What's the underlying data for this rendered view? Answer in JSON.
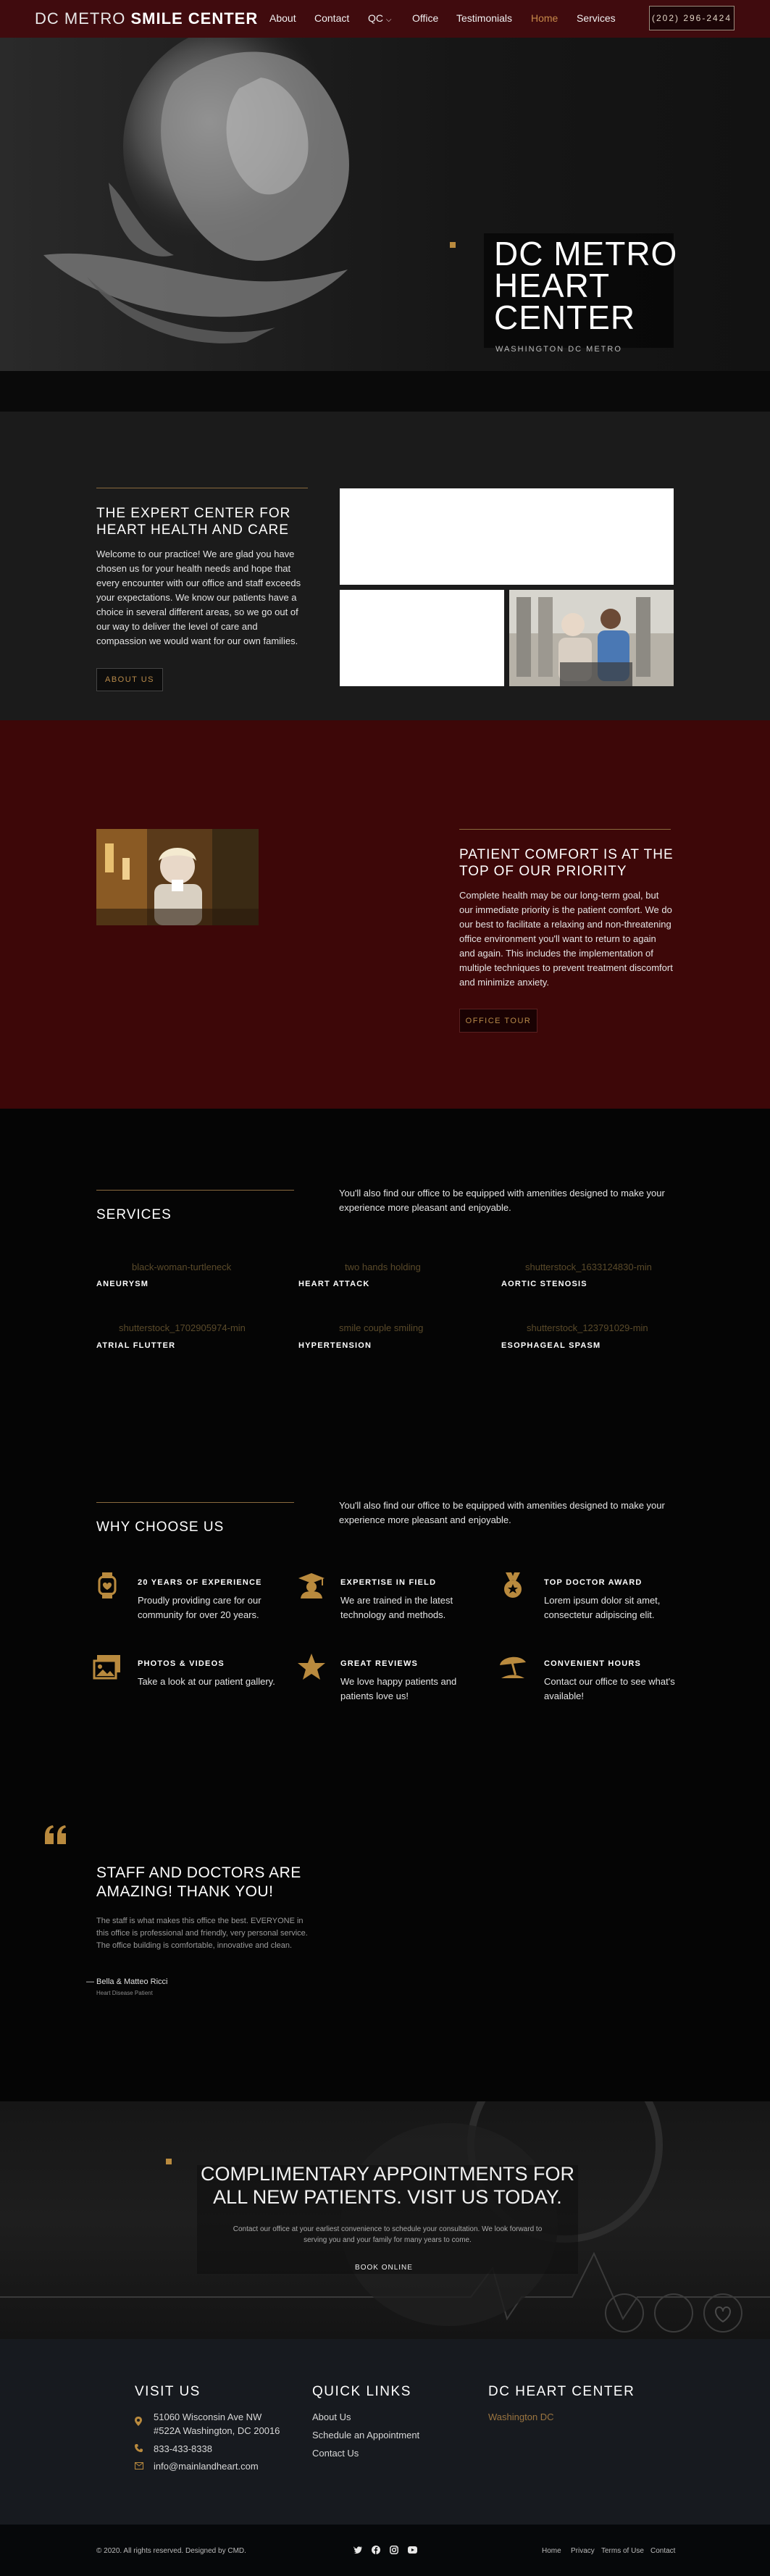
{
  "nav": {
    "logo_light": "DC METRO",
    "logo_bold": "SMILE CENTER",
    "links": [
      "About",
      "Contact",
      "QC",
      "Office",
      "Testimonials",
      "Home",
      "Services"
    ],
    "phone": "(202) 296-2424"
  },
  "hero": {
    "title_lines": [
      "DC METRO",
      "HEART",
      "CENTER"
    ],
    "subtitle": "WASHINGTON DC METRO"
  },
  "expert": {
    "title": "THE EXPERT CENTER FOR HEART HEALTH AND CARE",
    "body": "Welcome to our practice! We are glad you have chosen us for your health needs and hope that every encounter with our office and staff exceeds your expectations. We know our patients have a choice in several different areas, so we go out of our way to deliver the level of care and compassion we would want for our own families.",
    "button": "ABOUT US"
  },
  "comfort": {
    "title": "PATIENT COMFORT IS AT THE TOP OF OUR PRIORITY",
    "body": "Complete health may be our long-term goal, but our immediate priority is the patient comfort. We do our best to facilitate a relaxing and non-threatening office environment you'll want to return to again and again. This includes the implementation of multiple techniques to prevent treatment discomfort and minimize anxiety.",
    "button": "OFFICE TOUR"
  },
  "services": {
    "title": "SERVICES",
    "intro": "You'll also find our office to be equipped with amenities designed to make your experience more pleasant and enjoyable.",
    "items": [
      {
        "img": "black-woman-turtleneck",
        "name": "ANEURYSM"
      },
      {
        "img": "two hands holding",
        "name": "HEART ATTACK"
      },
      {
        "img": "shutterstock_1633124830-min",
        "name": "AORTIC STENOSIS"
      },
      {
        "img": "shutterstock_1702905974-min",
        "name": "ATRIAL FLUTTER"
      },
      {
        "img": "smile couple smiling",
        "name": "HYPERTENSION"
      },
      {
        "img": "shutterstock_123791029-min",
        "name": "ESOPHAGEAL SPASM"
      }
    ]
  },
  "why": {
    "title": "WHY CHOOSE US",
    "intro": "You'll also find our office to be equipped with amenities designed to make your experience more pleasant and enjoyable.",
    "items": [
      {
        "icon": "watch-icon",
        "title": "20 YEARS OF EXPERIENCE",
        "text": "Proudly providing care for our community for over 20 years."
      },
      {
        "icon": "graduate-icon",
        "title": "EXPERTISE IN FIELD",
        "text": "We are trained in the latest technology and methods."
      },
      {
        "icon": "medal-icon",
        "title": "TOP DOCTOR AWARD",
        "text": "Lorem ipsum dolor sit amet, consectetur adipiscing elit."
      },
      {
        "icon": "photos-icon",
        "title": "PHOTOS & VIDEOS",
        "text": "Take a look at our patient gallery."
      },
      {
        "icon": "star-icon",
        "title": "GREAT REVIEWS",
        "text": "We love happy patients and patients love us!"
      },
      {
        "icon": "umbrella-icon",
        "title": "CONVENIENT HOURS",
        "text": "Contact our office to see what's available!"
      }
    ]
  },
  "testimonial": {
    "title": "STAFF AND DOCTORS ARE AMAZING! THANK YOU!",
    "body": "The staff is what makes this office the best. EVERYONE in this office is professional and friendly, very personal service. The office building is comfortable, innovative and clean.",
    "author": "— Bella & Matteo Ricci",
    "role": "Heart Disease Patient"
  },
  "cta": {
    "title_lines": [
      "COMPLIMENTARY APPOINTMENTS FOR",
      "ALL NEW PATIENTS. VISIT US TODAY."
    ],
    "body_lines": [
      "Contact our office at your earliest convenience to schedule your consultation. We look forward to",
      "serving you and your family for many years to come."
    ],
    "button": "BOOK ONLINE"
  },
  "footer": {
    "visit_title": "VISIT US",
    "address_line1": "51060 Wisconsin Ave NW",
    "address_line2": "#522A Washington, DC 20016",
    "phone": "833-433-8338",
    "email": "info@mainlandheart.com",
    "links_title": "QUICK LINKS",
    "links": [
      "About Us",
      "Schedule an Appointment",
      "Contact Us"
    ],
    "center_title": "DC HEART CENTER",
    "center_location": "Washington DC",
    "copyright": "© 2020. All rights reserved. Designed by CMD.",
    "bottom_links": [
      "Home",
      "Privacy",
      "Terms of Use",
      "Contact"
    ]
  },
  "colors": {
    "accent": "#b98a3e",
    "maroon": "#3d0708",
    "nav": "#400b0e"
  }
}
